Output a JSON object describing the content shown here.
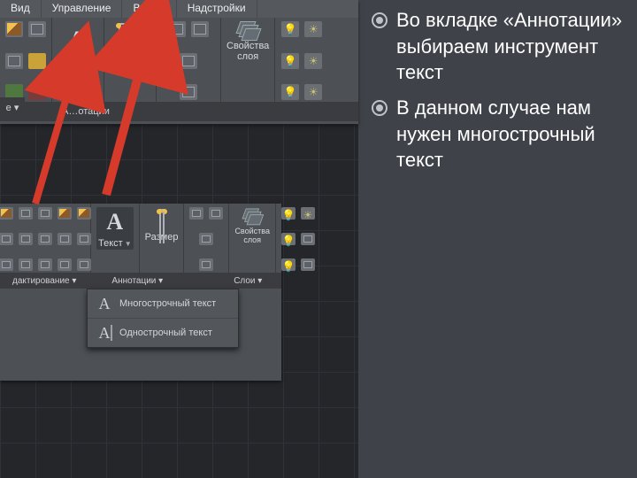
{
  "menubar": {
    "vid": "Вид",
    "upravlenie": "Управление",
    "vyvod": "Вывод",
    "nadstroyki": "Надстройки"
  },
  "ribbon": {
    "text_label": "Текст",
    "dim_label": "Разм…",
    "dim_label_full": "Размер",
    "props_label": "Свойства\nслоя",
    "panel_anno": "А…отации",
    "panel_anno_full": "Аннотации ▾",
    "panel_layers": "Слои ▾",
    "panel_edit": "дактирование ▾",
    "e_drop": "е ▾"
  },
  "dropdown": {
    "multi": "Многострочный текст",
    "single": "Однострочный текст"
  },
  "notes": {
    "b1": "Во вкладке «Аннотации» выбираем инструмент текст",
    "b2": "В данном случае нам нужен многострочный текст"
  }
}
